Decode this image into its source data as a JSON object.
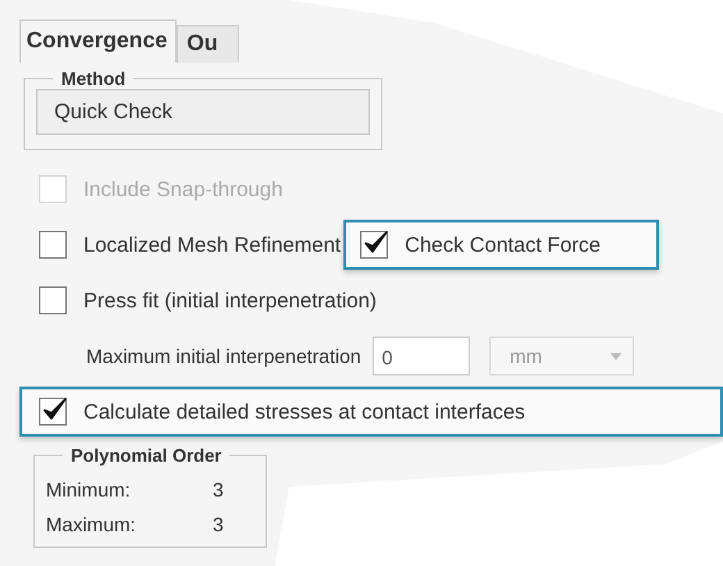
{
  "tabs": [
    {
      "label": "Convergence",
      "selected": true
    },
    {
      "label": "Ou",
      "selected": false
    }
  ],
  "method": {
    "legend": "Method",
    "value": "Quick Check"
  },
  "rows": [
    {
      "kind": "checks",
      "items": [
        {
          "label": "Include Snap-through",
          "checked": false,
          "disabled": true,
          "highlighted": false
        }
      ]
    },
    {
      "kind": "checks",
      "items": [
        {
          "label": "Localized Mesh Refinement",
          "checked": false,
          "disabled": false,
          "highlighted": false
        },
        {
          "label": "Check Contact Force",
          "checked": true,
          "disabled": false,
          "highlighted": true
        }
      ]
    },
    {
      "kind": "checks",
      "items": [
        {
          "label": "Press fit (initial interpenetration)",
          "checked": false,
          "disabled": false,
          "highlighted": false
        }
      ]
    },
    {
      "kind": "field",
      "label": "Maximum initial interpenetration",
      "value": "0",
      "unit": "mm"
    },
    {
      "kind": "checks",
      "items": [
        {
          "label": "Calculate detailed stresses at contact interfaces",
          "checked": true,
          "disabled": false,
          "highlighted": true
        }
      ]
    }
  ],
  "polynomial": {
    "legend": "Polynomial Order",
    "rows": [
      {
        "label": "Minimum:",
        "value": "3"
      },
      {
        "label": "Maximum:",
        "value": "3"
      }
    ]
  }
}
